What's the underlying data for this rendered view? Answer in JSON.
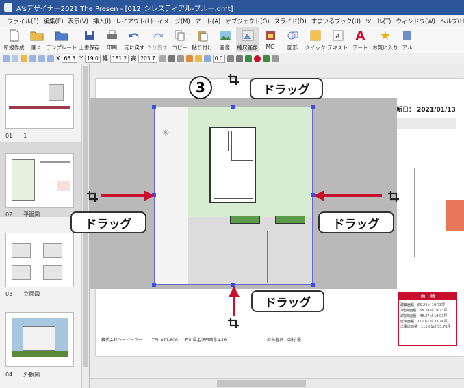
{
  "window": {
    "title": "A'sデザイナー2021 The Presen - [012_シレスティアル-ブルー.dmt]"
  },
  "menu": [
    "ファイル(F)",
    "編集(E)",
    "表示(V)",
    "挿入(I)",
    "レイアウト(L)",
    "イメージ(M)",
    "アート(A)",
    "オブジェクト(O)",
    "スライド(D)",
    "すまいるブック(U)",
    "ツール(T)",
    "ウィンドウ(W)",
    "ヘルプ(H)"
  ],
  "ribbon": [
    {
      "label": "新規作成",
      "icon": "new-doc-icon"
    },
    {
      "label": "開く",
      "icon": "open-folder-icon"
    },
    {
      "label": "テンプレート",
      "icon": "template-icon"
    },
    {
      "label": "上書保存",
      "icon": "save-icon"
    },
    {
      "label": "印刷",
      "icon": "print-icon"
    },
    {
      "label": "元に戻す",
      "icon": "undo-icon"
    },
    {
      "label": "やり直す",
      "icon": "redo-icon"
    },
    {
      "label": "コピー",
      "icon": "copy-icon"
    },
    {
      "label": "貼り付け",
      "icon": "paste-icon"
    },
    {
      "label": "画像",
      "icon": "image-icon"
    },
    {
      "label": "縮尺画像",
      "icon": "scaled-image-icon"
    },
    {
      "label": "MC",
      "icon": "mc-icon"
    },
    {
      "label": "図形",
      "icon": "shape-icon"
    },
    {
      "label": "クイック",
      "icon": "quick-icon"
    },
    {
      "label": "テキスト",
      "icon": "text-icon"
    },
    {
      "label": "アート",
      "icon": "art-icon"
    },
    {
      "label": "お気に入り",
      "icon": "favorite-star-icon"
    },
    {
      "label": "アル",
      "icon": "album-icon"
    }
  ],
  "propbar": {
    "x_label": "X",
    "x": "66.5",
    "y_label": "Y",
    "y": "19.0",
    "w_label": "幅",
    "w": "181.2",
    "h_label": "高",
    "h": "203.7",
    "rotate": "0.0"
  },
  "pages": [
    {
      "num": "01",
      "name": "1"
    },
    {
      "num": "02",
      "name": "平面図"
    },
    {
      "num": "03",
      "name": "立面図"
    },
    {
      "num": "04",
      "name": "外観図"
    }
  ],
  "document": {
    "date_text": "更新日： 2021/01/13",
    "footer_company": "株式会社シーピーユー",
    "footer_tel": "TEL 071-8061　石川県金沢市西念4-16",
    "footer_person": "担当者名：中村 優",
    "table_header": "面　積",
    "table_rows": [
      "建築面積　65.24㎡ 19.73坪",
      "1階床面積　65.24㎡ 19.73坪",
      "2階床面積　46.37㎡ 14.03坪",
      "延床面積　111.61㎡ 33.76坪",
      "工事床面積　111.61㎡ 33.76坪"
    ]
  },
  "step_number": "3",
  "callouts": {
    "top": "ドラッグ",
    "left": "ドラッグ",
    "right": "ドラッグ",
    "bottom": "ドラッグ"
  },
  "colors": {
    "accent_red": "#c8102e",
    "title_blue": "#2b579a",
    "handle_blue": "#3b4fe6",
    "orange_tab": "#e8765a"
  }
}
